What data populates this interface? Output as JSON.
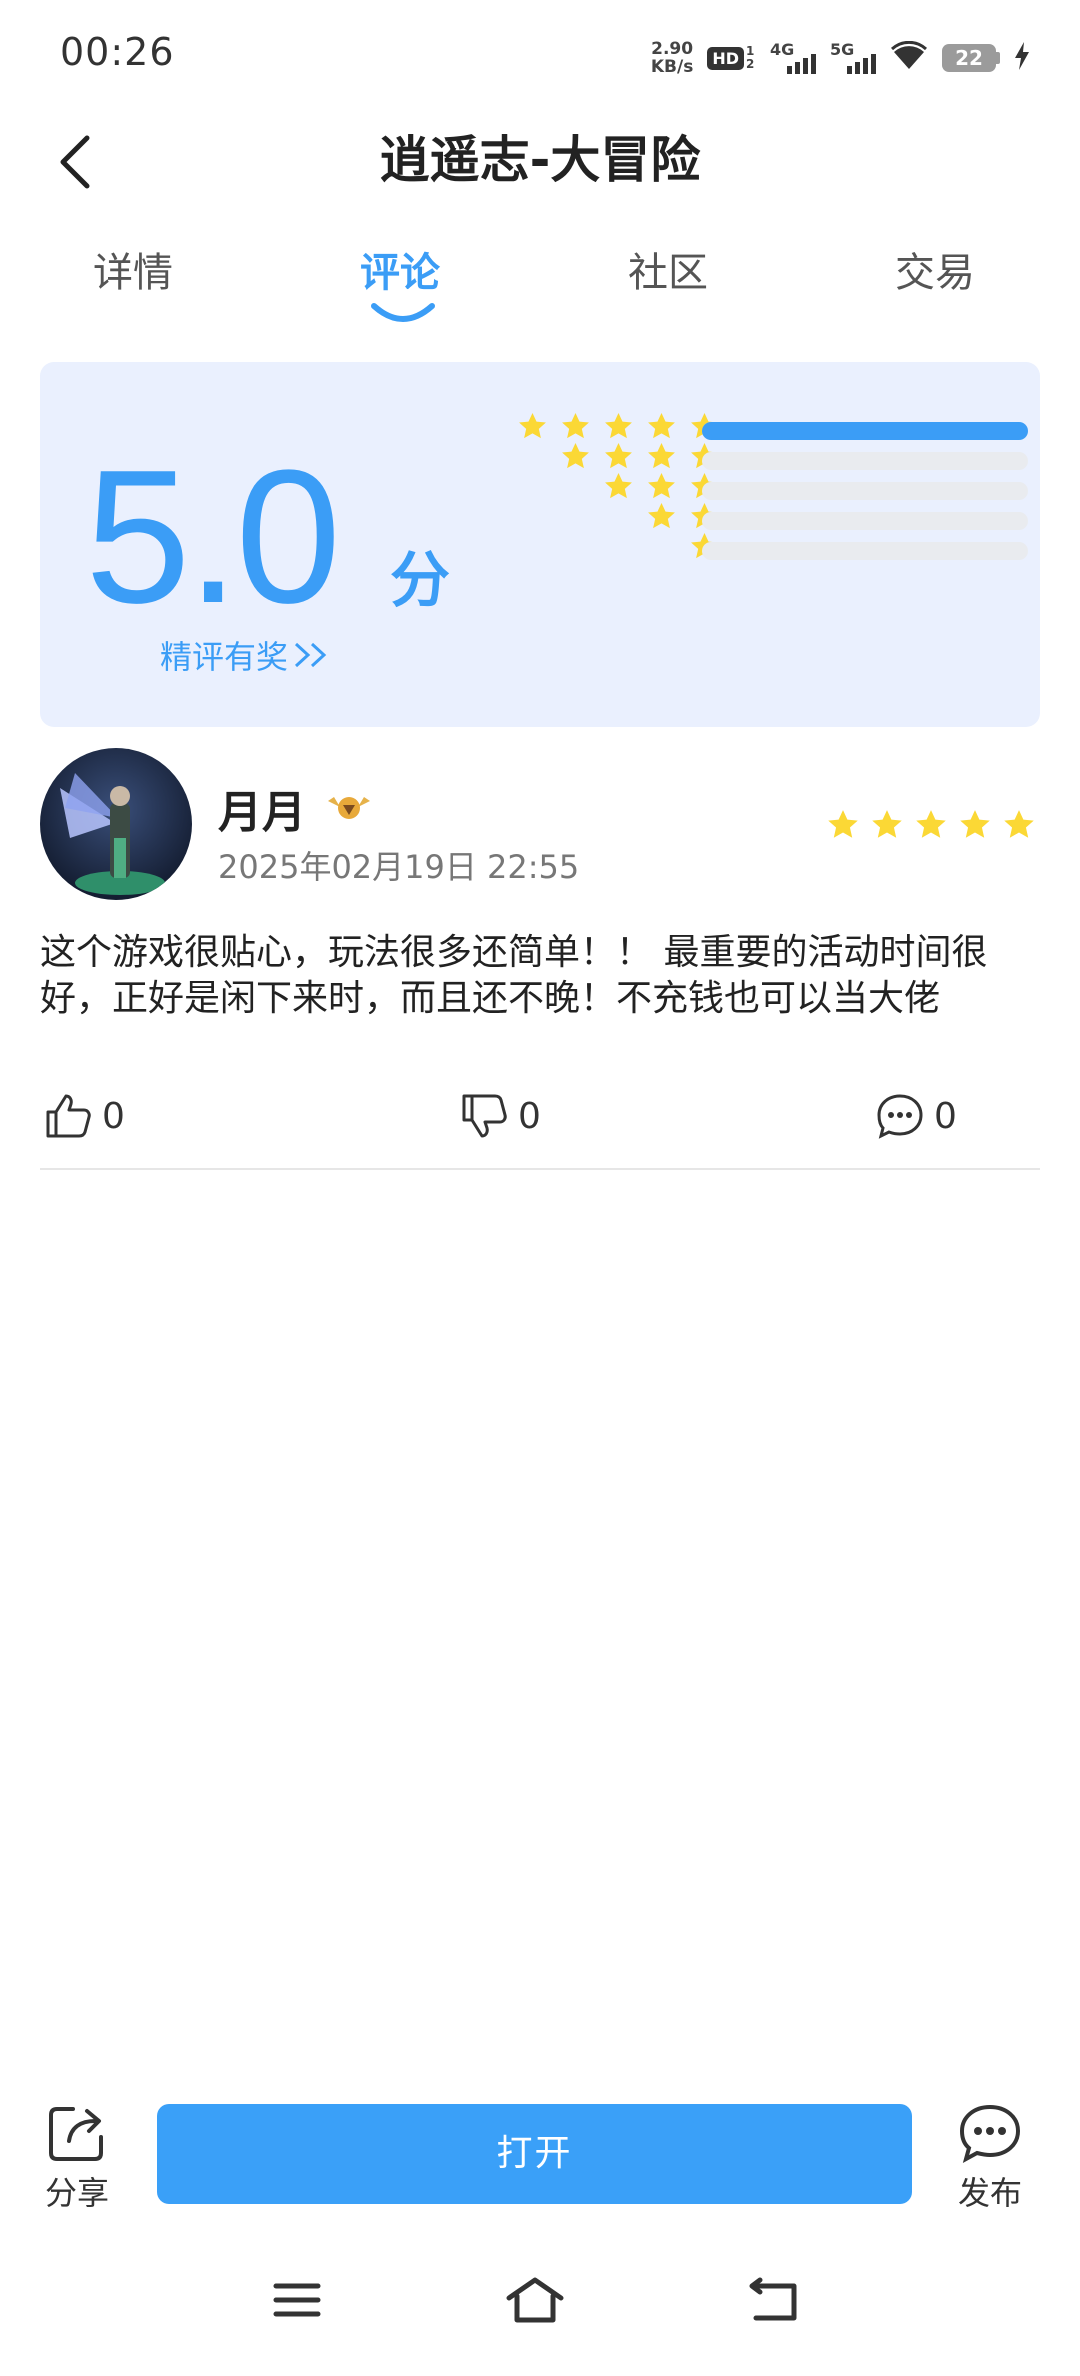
{
  "status_bar": {
    "time": "00:26",
    "speed_value": "2.90",
    "speed_unit": "KB/s",
    "hd": "HD",
    "hd_sub": "1 2",
    "net1": "4G",
    "net2": "5G",
    "battery": "22"
  },
  "header": {
    "title": "逍遥志-大冒险"
  },
  "tabs": [
    {
      "label": "详情"
    },
    {
      "label": "评论"
    },
    {
      "label": "社区"
    },
    {
      "label": "交易"
    }
  ],
  "active_tab": 1,
  "rating": {
    "score": "5.0",
    "unit": "分",
    "reward_link": "精评有奖",
    "distribution": [
      {
        "stars": 5,
        "fraction": 1.0
      },
      {
        "stars": 4,
        "fraction": 0.0
      },
      {
        "stars": 3,
        "fraction": 0.0
      },
      {
        "stars": 2,
        "fraction": 0.0
      },
      {
        "stars": 1,
        "fraction": 0.0
      }
    ]
  },
  "review": {
    "user_name": "月月",
    "date": "2025年02月19日 22:55",
    "stars": 5,
    "text": "这个游戏很贴心，玩法很多还简单！！ 最重要的活动时间很好，正好是闲下来时，而且还不晚！不充钱也可以当大佬",
    "likes": "0",
    "dislikes": "0",
    "comments": "0"
  },
  "bottom_bar": {
    "share_label": "分享",
    "open_label": "打开",
    "publish_label": "发布"
  },
  "colors": {
    "accent": "#3b9df6",
    "star": "#fbd835",
    "card_bg": "#eaf0fe"
  }
}
